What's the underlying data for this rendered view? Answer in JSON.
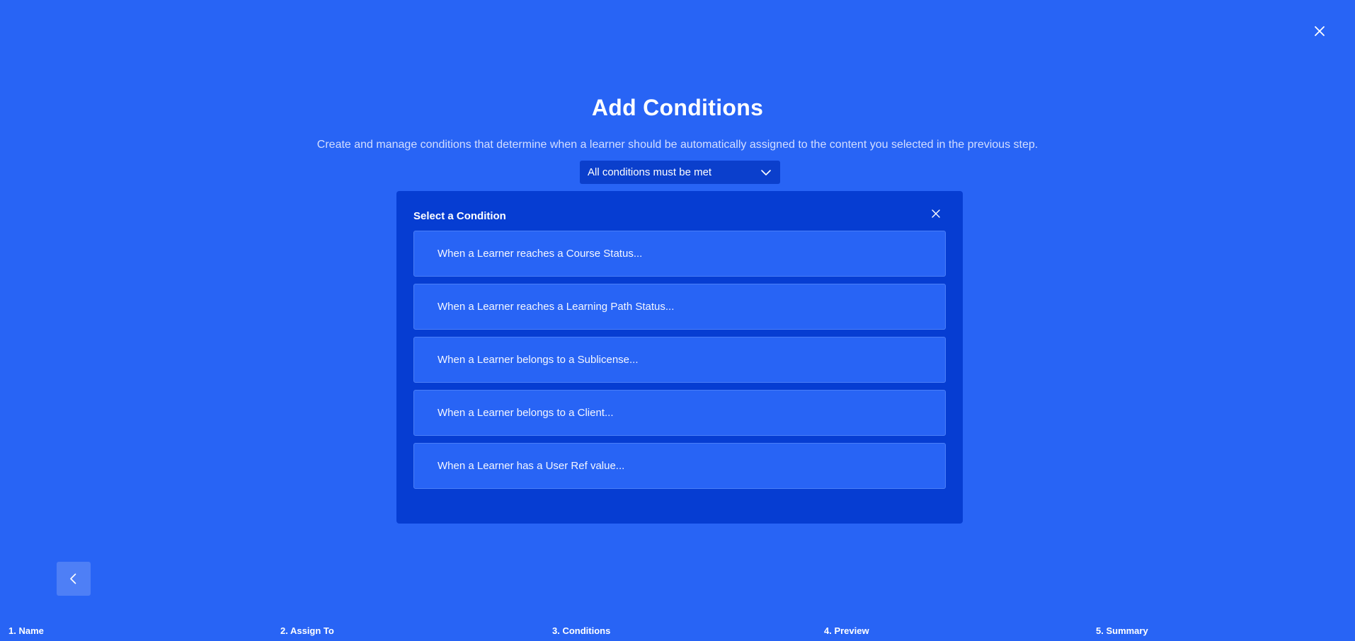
{
  "header": {
    "close_icon": "close-icon",
    "title": "Add Conditions",
    "subtitle": "Create and manage conditions that determine when a learner should be automatically assigned to the content you selected in the previous step."
  },
  "match_select": {
    "value": "All conditions must be met",
    "icon": "chevron-down-icon"
  },
  "condition_panel": {
    "title": "Select a Condition",
    "close_icon": "close-icon",
    "options": [
      "When a Learner reaches a Course Status...",
      "When a Learner reaches a Learning Path Status...",
      "When a Learner belongs to a Sublicense...",
      "When a Learner belongs to a Client...",
      "When a Learner has a User Ref value..."
    ]
  },
  "back_button": {
    "icon": "chevron-left-icon"
  },
  "steps": [
    "1. Name",
    "2. Assign To",
    "3. Conditions",
    "4. Preview",
    "5. Summary"
  ],
  "colors": {
    "background": "#2864f5",
    "panel": "#063dd2",
    "dropdown": "#0b3fcc",
    "option": "#2864f5",
    "back_button": "#4e7ff6"
  }
}
